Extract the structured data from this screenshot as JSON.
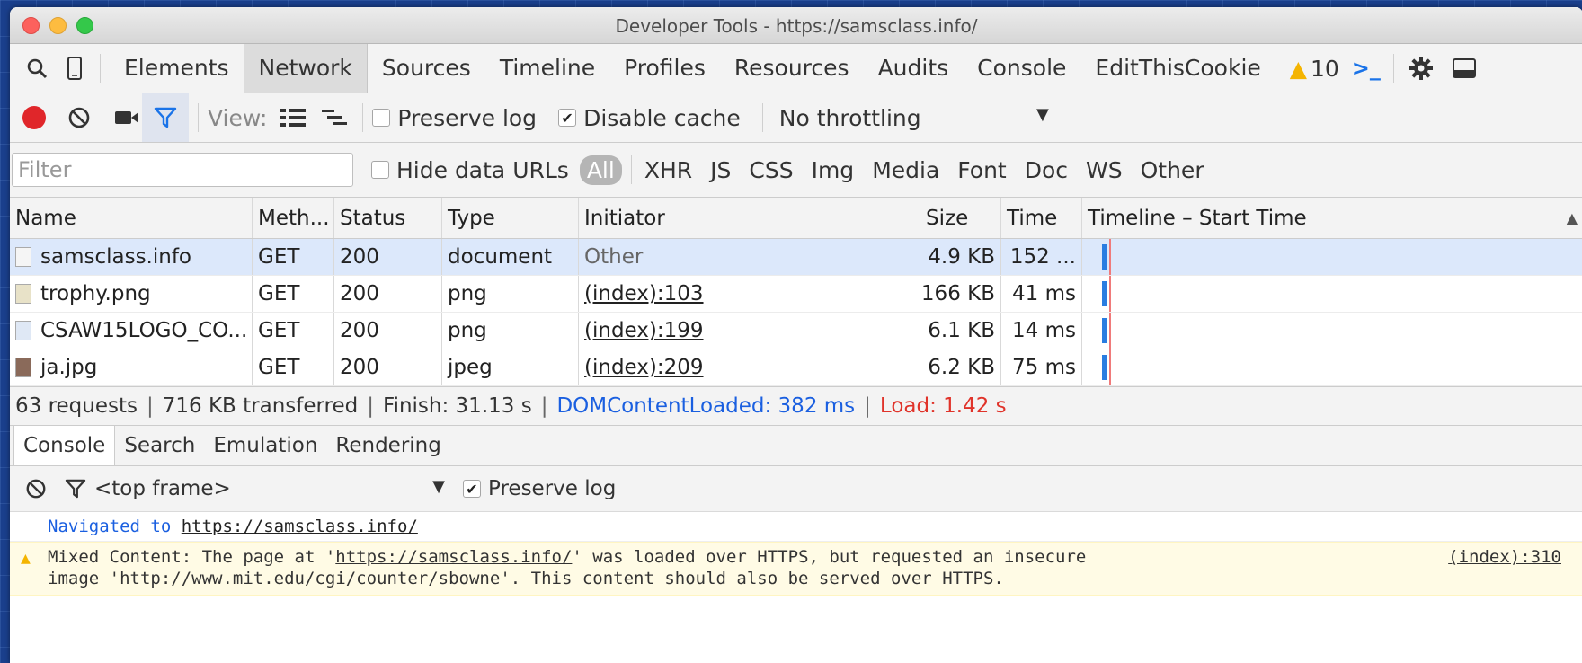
{
  "window": {
    "title": "Developer Tools - https://samsclass.info/"
  },
  "main_tabs": [
    {
      "label": "Elements"
    },
    {
      "label": "Network",
      "active": true
    },
    {
      "label": "Sources"
    },
    {
      "label": "Timeline"
    },
    {
      "label": "Profiles"
    },
    {
      "label": "Resources"
    },
    {
      "label": "Audits"
    },
    {
      "label": "Console"
    },
    {
      "label": "EditThisCookie"
    }
  ],
  "warning_count": "10",
  "toolbar": {
    "view_label": "View:",
    "preserve_log_label": "Preserve log",
    "preserve_log_checked": false,
    "disable_cache_label": "Disable cache",
    "disable_cache_checked": true,
    "throttling_value": "No throttling"
  },
  "filter": {
    "placeholder": "Filter",
    "hide_data_urls_label": "Hide data URLs",
    "types": [
      "All",
      "XHR",
      "JS",
      "CSS",
      "Img",
      "Media",
      "Font",
      "Doc",
      "WS",
      "Other"
    ]
  },
  "table": {
    "headers": {
      "name": "Name",
      "method": "Meth...",
      "status": "Status",
      "type": "Type",
      "initiator": "Initiator",
      "size": "Size",
      "time": "Time",
      "timeline": "Timeline – Start Time"
    },
    "rows": [
      {
        "name": "samsclass.info",
        "method": "GET",
        "status": "200",
        "type": "document",
        "initiator": "Other",
        "size": "4.9 KB",
        "time": "152 ..."
      },
      {
        "name": "trophy.png",
        "method": "GET",
        "status": "200",
        "type": "png",
        "initiator": "(index):103",
        "size": "166 KB",
        "time": "41 ms"
      },
      {
        "name": "CSAW15LOGO_CO...",
        "method": "GET",
        "status": "200",
        "type": "png",
        "initiator": "(index):199",
        "size": "6.1 KB",
        "time": "14 ms"
      },
      {
        "name": "ja.jpg",
        "method": "GET",
        "status": "200",
        "type": "jpeg",
        "initiator": "(index):209",
        "size": "6.2 KB",
        "time": "75 ms"
      }
    ]
  },
  "summary": {
    "requests": "63 requests",
    "transferred": "716 KB transferred",
    "finish": "Finish: 31.13 s",
    "dom_loaded": "DOMContentLoaded: 382 ms",
    "load": "Load: 1.42 s"
  },
  "drawer": {
    "tabs": [
      "Console",
      "Search",
      "Emulation",
      "Rendering"
    ],
    "frame": "<top frame>",
    "preserve_log_label": "Preserve log",
    "preserve_log_checked": true
  },
  "console": {
    "nav_prefix": "Navigated to",
    "nav_url": "https://samsclass.info/",
    "warn_prefix": "Mixed Content: The page at '",
    "warn_url": "https://samsclass.info/",
    "warn_line1_rest": "' was loaded over HTTPS, but requested an insecure",
    "warn_line2": "image 'http://www.mit.edu/cgi/counter/sbowne'. This content should also be served over HTTPS.",
    "warn_source": "(index):310"
  },
  "colors": {
    "record": "#e0262a",
    "dom_loaded": "#1a5fe0",
    "load": "#e0332a",
    "selected_row": "#dce8fb",
    "warning_bg": "#fffbe5"
  }
}
